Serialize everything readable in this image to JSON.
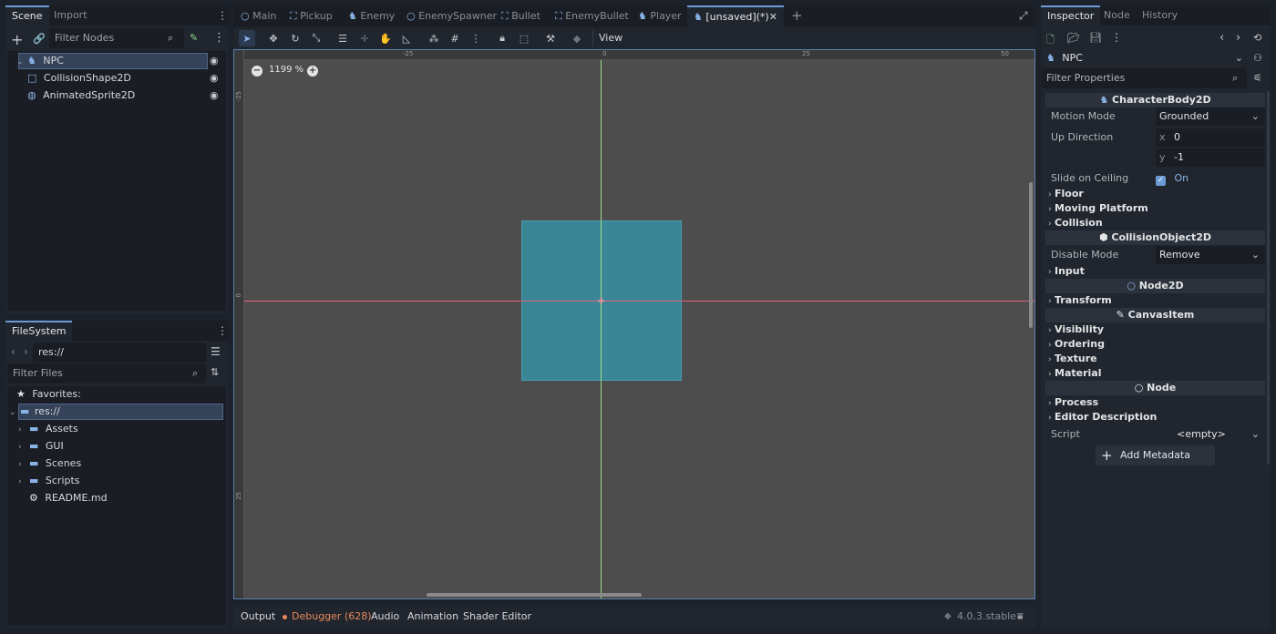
{
  "scene_dock": {
    "tabs": [
      "Scene",
      "Import"
    ],
    "filter_placeholder": "Filter Nodes",
    "nodes": [
      {
        "name": "NPC",
        "icon": "character-body-icon"
      },
      {
        "name": "CollisionShape2D",
        "icon": "collision-shape-icon"
      },
      {
        "name": "AnimatedSprite2D",
        "icon": "animated-sprite-icon"
      }
    ]
  },
  "filesystem": {
    "tab": "FileSystem",
    "path": "res://",
    "filter_placeholder": "Filter Files",
    "favorites": "Favorites:",
    "root": "res://",
    "items": [
      "Assets",
      "GUI",
      "Scenes",
      "Scripts"
    ],
    "file": "README.md"
  },
  "scene_tabs": [
    {
      "label": "Main",
      "icon": "node-icon"
    },
    {
      "label": "Pickup",
      "icon": "area-icon"
    },
    {
      "label": "Enemy",
      "icon": "character-body-icon"
    },
    {
      "label": "EnemySpawner",
      "icon": "node-icon"
    },
    {
      "label": "Bullet",
      "icon": "area-icon"
    },
    {
      "label": "EnemyBullet",
      "icon": "area-icon"
    },
    {
      "label": "Player",
      "icon": "character-body-icon"
    },
    {
      "label": "[unsaved](*)",
      "icon": "character-body-icon"
    }
  ],
  "viewport": {
    "view_menu": "View",
    "zoom": "1199 %",
    "ruler_top": [
      "-25",
      "0",
      "25",
      "50"
    ],
    "ruler_left": [
      "-25",
      "0",
      "25"
    ],
    "colors": {
      "background": "#4d4d4d",
      "shape": "#3a8a9a",
      "x_axis": "#e0627a",
      "y_axis": "#9edc8c"
    }
  },
  "bottom_panel": {
    "tabs": [
      "Output",
      "Debugger (628)",
      "Audio",
      "Animation",
      "Shader Editor"
    ],
    "version": "4.0.3.stable"
  },
  "inspector": {
    "tabs": [
      "Inspector",
      "Node",
      "History"
    ],
    "object": "NPC",
    "filter_placeholder": "Filter Properties",
    "sections": {
      "character_body": "CharacterBody2D",
      "collision_object": "CollisionObject2D",
      "node2d": "Node2D",
      "canvas_item": "CanvasItem",
      "node": "Node"
    },
    "motion_mode": {
      "label": "Motion Mode",
      "value": "Grounded"
    },
    "up_direction": {
      "label": "Up Direction",
      "x_label": "x",
      "x": "0",
      "y_label": "y",
      "y": "-1"
    },
    "slide_on_ceiling": {
      "label": "Slide on Ceiling",
      "value": "On"
    },
    "groups_body": [
      "Floor",
      "Moving Platform",
      "Collision"
    ],
    "disable_mode": {
      "label": "Disable Mode",
      "value": "Remove"
    },
    "groups_collision": [
      "Input"
    ],
    "groups_node2d": [
      "Transform"
    ],
    "groups_canvas": [
      "Visibility",
      "Ordering",
      "Texture",
      "Material"
    ],
    "groups_node": [
      "Process",
      "Editor Description"
    ],
    "script": {
      "label": "Script",
      "value": "<empty>"
    },
    "add_metadata": "Add Metadata"
  }
}
